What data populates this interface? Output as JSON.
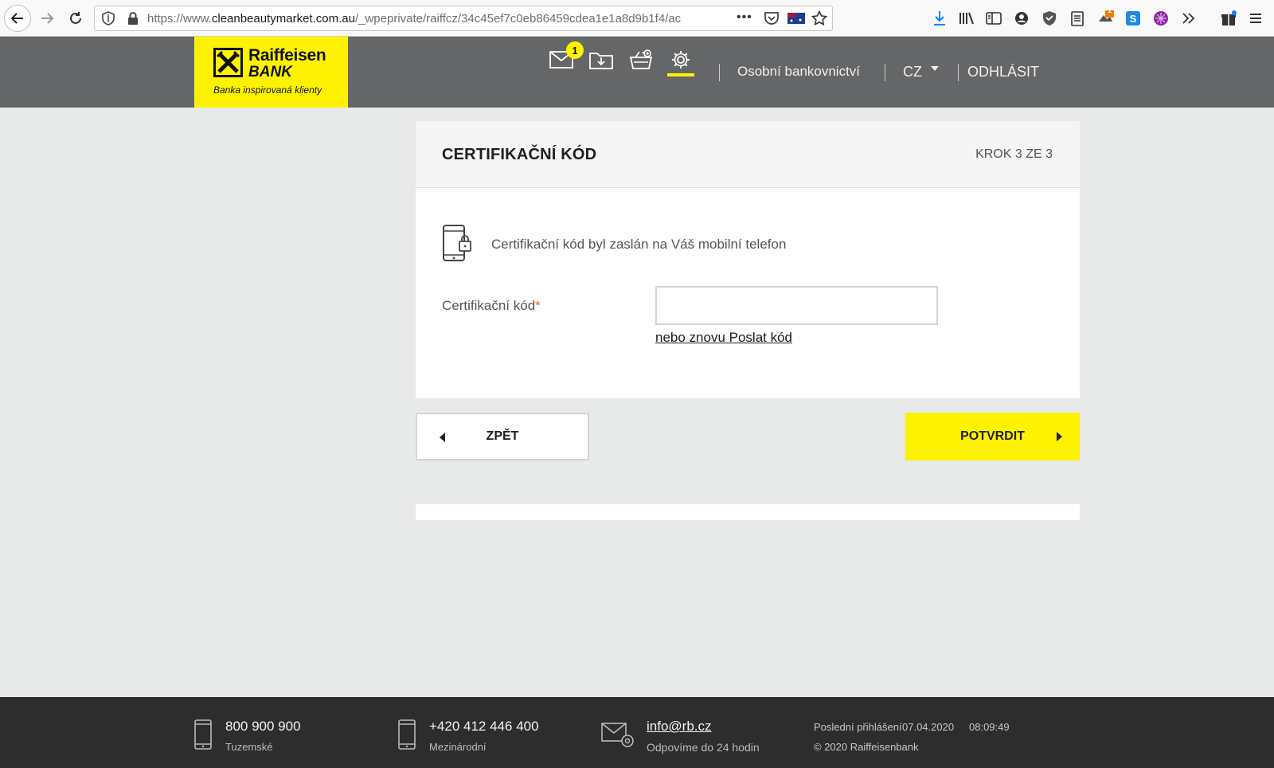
{
  "browser": {
    "url_prefix": "https://www.",
    "url_domain": "cleanbeautymarket.com.au",
    "url_path": "/_wpeprivate/raiffcz/34c45ef7c0eb86459cdea1e1a8d9b1f4/ac",
    "menu_dots": "•••",
    "ext_badge": "1"
  },
  "logo": {
    "brand_line1": "Raiffeisen",
    "brand_line2": "BANK",
    "tagline": "Banka inspirovaná klienty"
  },
  "header": {
    "messages_badge": "1",
    "personal_banking": "Osobní bankovnictví",
    "language": "CZ",
    "logout": "ODHLÁSIT"
  },
  "card": {
    "title": "CERTIFIKAČNÍ KÓD",
    "step": "KROK 3 ZE 3",
    "info": "Certifikační kód byl zaslán na Váš mobilní telefon",
    "field_label": "Certifikační kód",
    "required_mark": "*",
    "input_value": "",
    "resend_link": "nebo znovu Poslat kód"
  },
  "actions": {
    "back_label": "ZPĚT",
    "confirm_label": "POTVRDIT"
  },
  "footer": {
    "phone_domestic": "800 900 900",
    "phone_domestic_label": "Tuzemské",
    "phone_intl": "+420 412 446 400",
    "phone_intl_label": "Mezinárodní",
    "email": "info@rb.cz",
    "email_note": "Odpovíme do 24 hodin",
    "last_login_label": "Poslední přihlášení",
    "last_login_date": "07.04.2020",
    "last_login_time": "08:09:49",
    "copyright": "© 2020 Raiffeisenbank"
  },
  "colors": {
    "brand_yellow": "#fff200",
    "header_gray": "#656667",
    "footer_dark": "#2d2d2d",
    "background": "#e8e9e9"
  }
}
